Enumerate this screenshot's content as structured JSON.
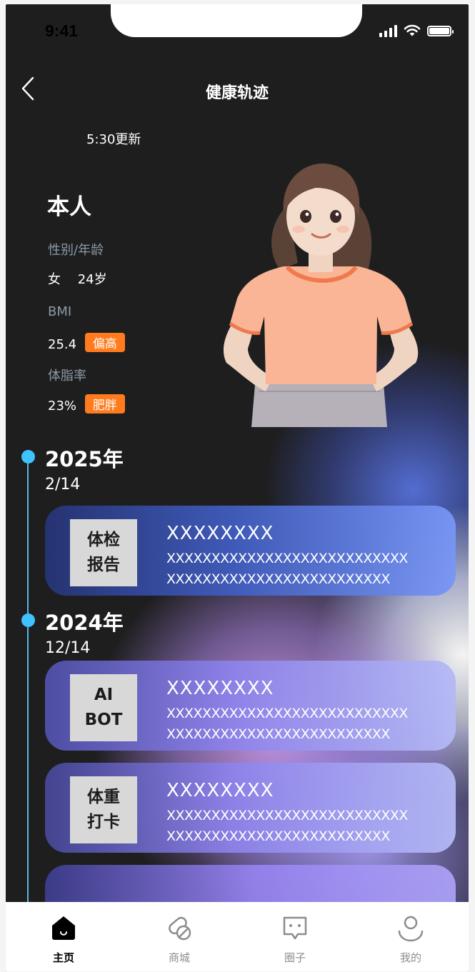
{
  "status_bar": {
    "time": "9:41"
  },
  "header": {
    "title": "健康轨迹"
  },
  "profile": {
    "updated": "5:30更新",
    "name": "本人",
    "gender_age_label": "性别/年龄",
    "gender": "女",
    "age": "24岁",
    "bmi_label": "BMI",
    "bmi_value": "25.4",
    "bmi_tag": "偏高",
    "bodyfat_label": "体脂率",
    "bodyfat_value": "23%",
    "bodyfat_tag": "肥胖"
  },
  "timeline": {
    "accent_color": "#3fc3ff",
    "groups": [
      {
        "year": "2025年",
        "date": "2/14",
        "cards": [
          {
            "icon_label": "体检\n报告",
            "title": "XXXXXXXX",
            "line1": "XXXXXXXXXXXXXXXXXXXXXXXXXXX",
            "line2": "XXXXXXXXXXXXXXXXXXXXXXXXX"
          }
        ]
      },
      {
        "year": "2024年",
        "date": "12/14",
        "cards": [
          {
            "icon_label": "AI\nBOT",
            "title": "XXXXXXXX",
            "line1": "XXXXXXXXXXXXXXXXXXXXXXXXXXX",
            "line2": "XXXXXXXXXXXXXXXXXXXXXXXXX"
          },
          {
            "icon_label": "体重\n打卡",
            "title": "XXXXXXXX",
            "line1": "XXXXXXXXXXXXXXXXXXXXXXXXXXX",
            "line2": "XXXXXXXXXXXXXXXXXXXXXXXXX"
          }
        ]
      }
    ]
  },
  "tabbar": {
    "items": [
      {
        "label": "主页",
        "icon": "home-icon",
        "active": true
      },
      {
        "label": "商城",
        "icon": "pill-icon",
        "active": false
      },
      {
        "label": "圈子",
        "icon": "chat-icon",
        "active": false
      },
      {
        "label": "我的",
        "icon": "user-icon",
        "active": false
      }
    ]
  },
  "colors": {
    "tag": "#ff7b1d",
    "background": "#1e1e1f"
  }
}
